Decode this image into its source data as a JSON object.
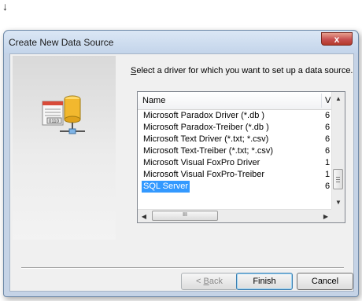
{
  "dialog": {
    "title": "Create New Data Source",
    "close_symbol": "x",
    "prompt_before": "",
    "prompt_underlined": "S",
    "prompt_after": "elect a driver for which you want to set up a data source."
  },
  "icons": {
    "arrow": "down-arrow-icon",
    "close": "close-icon",
    "side": "data-source-icon"
  },
  "driver_list": {
    "headers": {
      "name": "Name",
      "version": "V"
    },
    "items": [
      {
        "name": "Microsoft Paradox Driver (*.db )",
        "version": "6"
      },
      {
        "name": "Microsoft Paradox-Treiber (*.db )",
        "version": "6"
      },
      {
        "name": "Microsoft Text Driver (*.txt; *.csv)",
        "version": "6"
      },
      {
        "name": "Microsoft Text-Treiber (*.txt; *.csv)",
        "version": "6"
      },
      {
        "name": "Microsoft Visual FoxPro Driver",
        "version": "1"
      },
      {
        "name": "Microsoft Visual FoxPro-Treiber",
        "version": "1"
      },
      {
        "name": "SQL Server",
        "version": "6"
      }
    ],
    "selected_index": 6,
    "hscroll_thumb_grip": "III"
  },
  "buttons": {
    "back_prefix": "< ",
    "back_underlined": "B",
    "back_rest": "ack",
    "finish": "Finish",
    "cancel": "Cancel"
  },
  "colors": {
    "selection": "#3399ff",
    "close_button": "#c75050"
  }
}
